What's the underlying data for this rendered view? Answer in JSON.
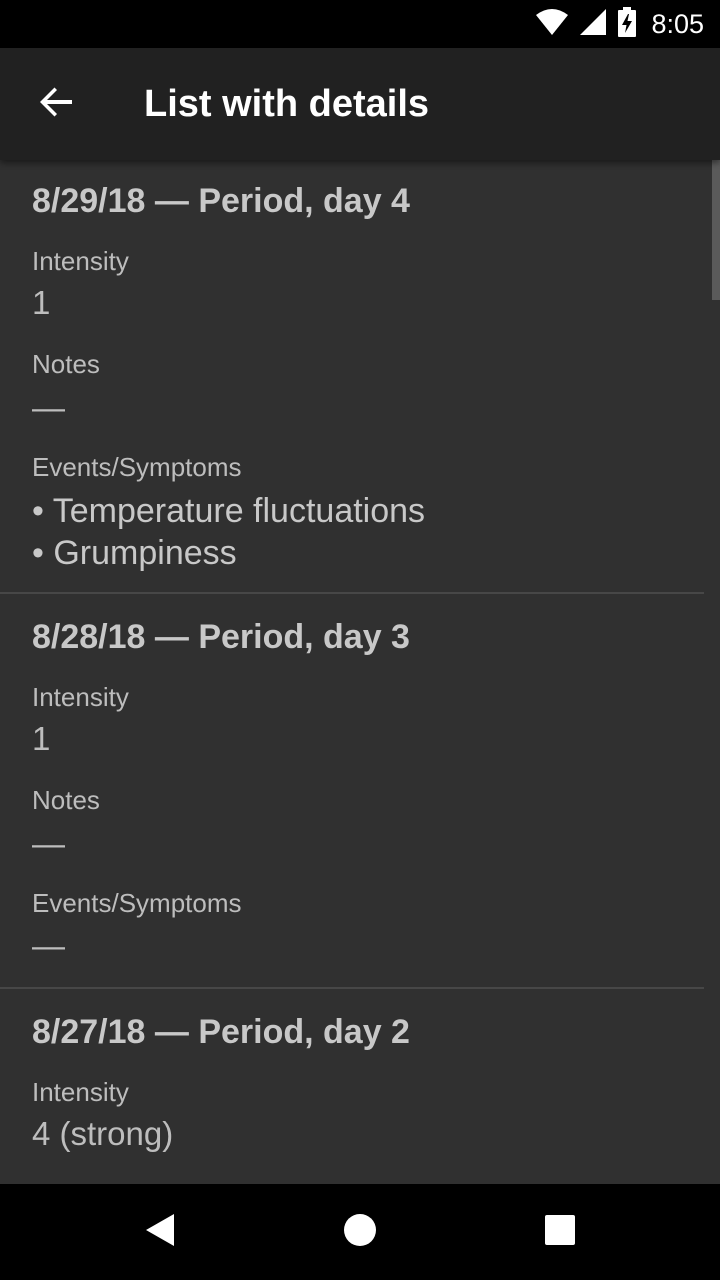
{
  "status_bar": {
    "time": "8:05",
    "icons": [
      "wifi-icon",
      "cell-signal-icon",
      "battery-charging-icon"
    ]
  },
  "app_bar": {
    "title": "List with details",
    "back_icon": "arrow-back-icon"
  },
  "entries": [
    {
      "title": "8/29/18 — Period, day 4",
      "intensity_label": "Intensity",
      "intensity_value": "1",
      "notes_label": "Notes",
      "notes_value": "—",
      "events_label": "Events/Symptoms",
      "events": [
        "• Temperature fluctuations",
        "• Grumpiness"
      ]
    },
    {
      "title": "8/28/18 — Period, day 3",
      "intensity_label": "Intensity",
      "intensity_value": "1",
      "notes_label": "Notes",
      "notes_value": "—",
      "events_label": "Events/Symptoms",
      "events_value": "—"
    },
    {
      "title": "8/27/18 — Period, day 2",
      "intensity_label": "Intensity",
      "intensity_value": "4 (strong)"
    }
  ],
  "nav_bar": {
    "icons": [
      "back-triangle-icon",
      "home-circle-icon",
      "recents-square-icon"
    ]
  },
  "colors": {
    "background": "#303030",
    "app_bar": "#212121",
    "status_bar": "#000000",
    "text_primary": "#c8c8c8",
    "text_secondary": "#bdbdbd"
  }
}
